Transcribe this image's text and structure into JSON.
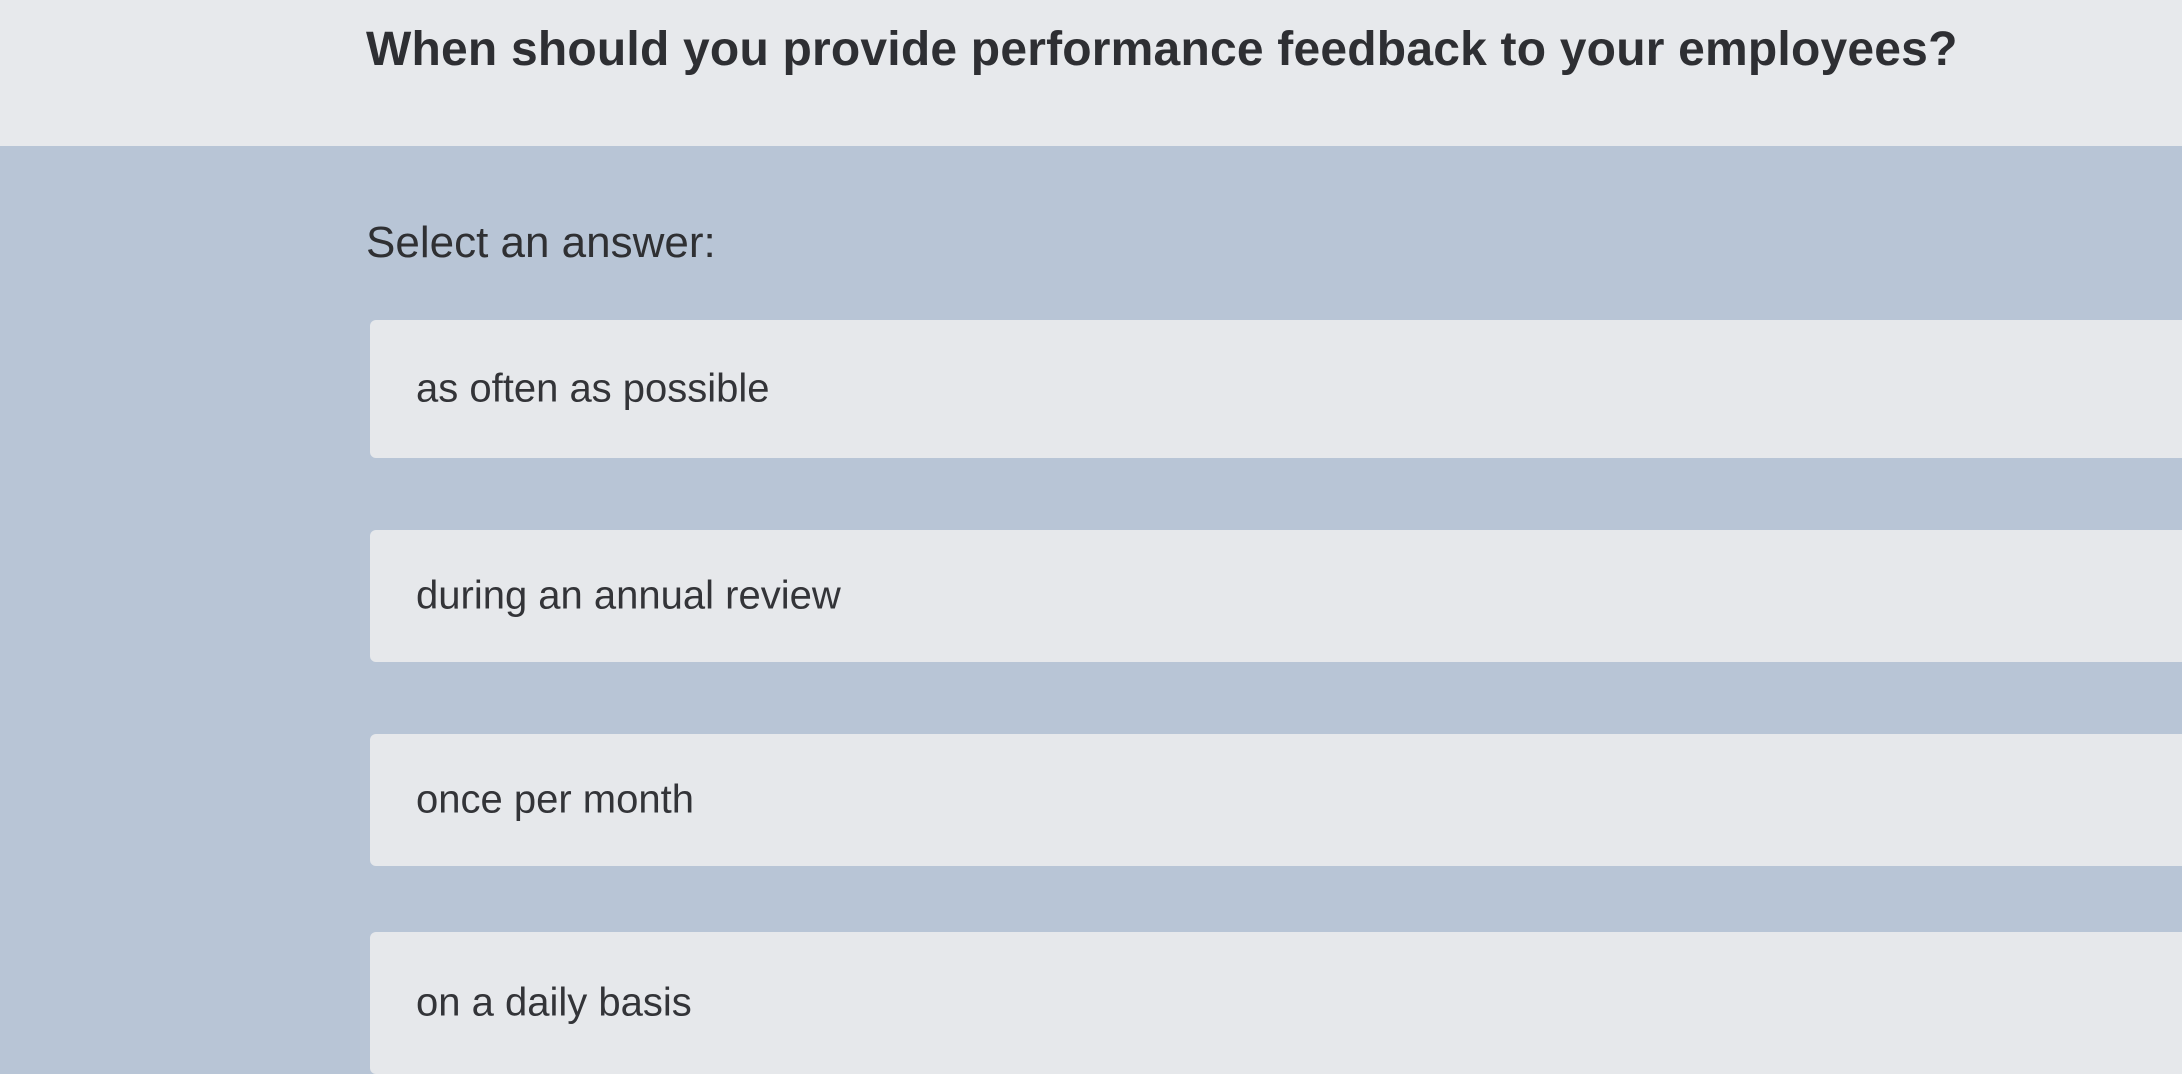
{
  "question": {
    "text": "When should you provide performance feedback to your employees?"
  },
  "prompt": {
    "label": "Select an answer:"
  },
  "options": [
    {
      "label": "as often as possible"
    },
    {
      "label": "during an annual review"
    },
    {
      "label": "once per month"
    },
    {
      "label": "on a daily basis"
    }
  ],
  "colors": {
    "background": "#e9ebee",
    "answer_area": "#b8c5d6",
    "option_background": "#e6e8eb",
    "text": "#2e2f33"
  }
}
